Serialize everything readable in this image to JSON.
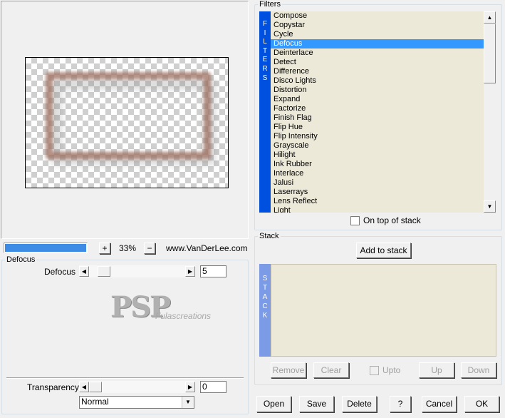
{
  "filters": {
    "group_label": "Filters",
    "strip_letters": [
      "F",
      "I",
      "L",
      "T",
      "E",
      "R",
      "S"
    ],
    "items": [
      "Compose",
      "Copystar",
      "Cycle",
      "Defocus",
      "Deinterlace",
      "Detect",
      "Difference",
      "Disco Lights",
      "Distortion",
      "Expand",
      "Factorize",
      "Finish Flag",
      "Flip Hue",
      "Flip Intensity",
      "Grayscale",
      "Hilight",
      "Ink Rubber",
      "Interlace",
      "Jalusi",
      "Laserrays",
      "Lens Reflect",
      "Light"
    ],
    "selected": "Defocus",
    "on_top_label": "On top of stack",
    "on_top_checked": false
  },
  "stack": {
    "group_label": "Stack",
    "add_label": "Add to stack",
    "strip_letters": [
      "S",
      "T",
      "A",
      "C",
      "K"
    ],
    "remove_label": "Remove",
    "clear_label": "Clear",
    "upto_label": "Upto",
    "up_label": "Up",
    "down_label": "Down"
  },
  "zoom": {
    "plus": "+",
    "minus": "−",
    "value": "33%",
    "website": "www.VanDerLee.com",
    "progress": 1.0
  },
  "params": {
    "group_label": "Defocus",
    "defocus_label": "Defocus",
    "defocus_value": "5",
    "transparency_label": "Transparency",
    "transparency_value": "0",
    "blend_mode": "Normal"
  },
  "watermark": {
    "logo": "PSP",
    "text": "Fulascreations"
  },
  "buttons": {
    "open": "Open",
    "save": "Save",
    "delete": "Delete",
    "help": "?",
    "cancel": "Cancel",
    "ok": "OK"
  },
  "colors": {
    "filters_strip": "#0050e0",
    "stack_strip": "#7b9be6",
    "selection": "#3399ff",
    "list_bg": "#ece9d8",
    "frame": "#a07060"
  }
}
